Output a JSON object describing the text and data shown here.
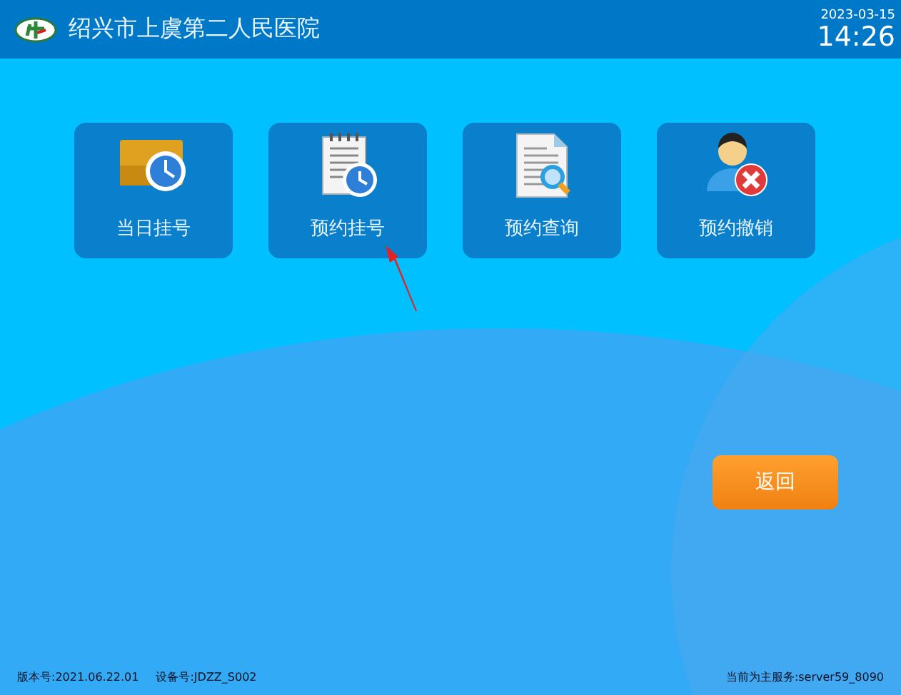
{
  "header": {
    "title": "绍兴市上虞第二人民医院",
    "date": "2023-03-15",
    "time": "14:26"
  },
  "tiles": [
    {
      "label": "当日挂号",
      "kind": "today"
    },
    {
      "label": "预约挂号",
      "kind": "appointment"
    },
    {
      "label": "预约查询",
      "kind": "query"
    },
    {
      "label": "预约撤销",
      "kind": "cancel"
    }
  ],
  "back_button": "返回",
  "footer": {
    "version": "版本号:2021.06.22.01",
    "device": "设备号:JDZZ_S002",
    "server": "当前为主服务:server59_8090"
  }
}
